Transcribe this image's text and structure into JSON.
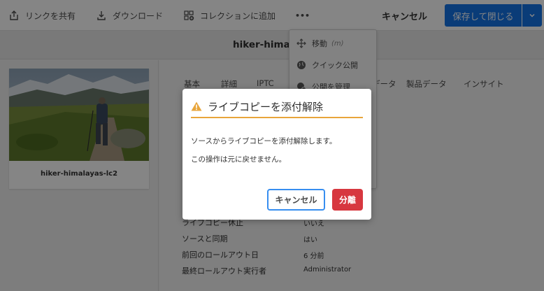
{
  "toolbar": {
    "share_link": "リンクを共有",
    "download": "ダウンロード",
    "add_to_collection": "コレクションに追加",
    "more": "•••",
    "cancel": "キャンセル",
    "save_close": "保存して閉じる"
  },
  "header": {
    "title": "hiker-himalayas-lc2"
  },
  "asset": {
    "name": "hiker-himalayas-lc2"
  },
  "tabs": [
    "基本",
    "詳細",
    "IPTC",
    "データ",
    "製品データ",
    "インサイト"
  ],
  "properties": [
    {
      "label": "ライブコピー休止",
      "value": "いいえ"
    },
    {
      "label": "ソースと同期",
      "value": "はい"
    },
    {
      "label": "前回のロールアウト日",
      "value": "6 分前"
    },
    {
      "label": "最終ロールアウト実行者",
      "value": "Administrator"
    }
  ],
  "menu": {
    "items": [
      {
        "label": "移動",
        "shortcut": "(m)",
        "icon": "move-icon"
      },
      {
        "label": "クイック公開",
        "shortcut": "",
        "icon": "globe-icon"
      },
      {
        "label": "公開を管理",
        "shortcut": "",
        "icon": "globe-gear-icon"
      }
    ]
  },
  "dialog": {
    "title": "ライブコピーを添付解除",
    "message1": "ソースからライブコピーを添付解除します。",
    "message2": "この操作は元に戻せません。",
    "cancel": "キャンセル",
    "confirm": "分離"
  },
  "colors": {
    "primary": "#1473e6",
    "warning": "#e8a53b",
    "destructive": "#d7373f",
    "focus": "#378ef0"
  }
}
